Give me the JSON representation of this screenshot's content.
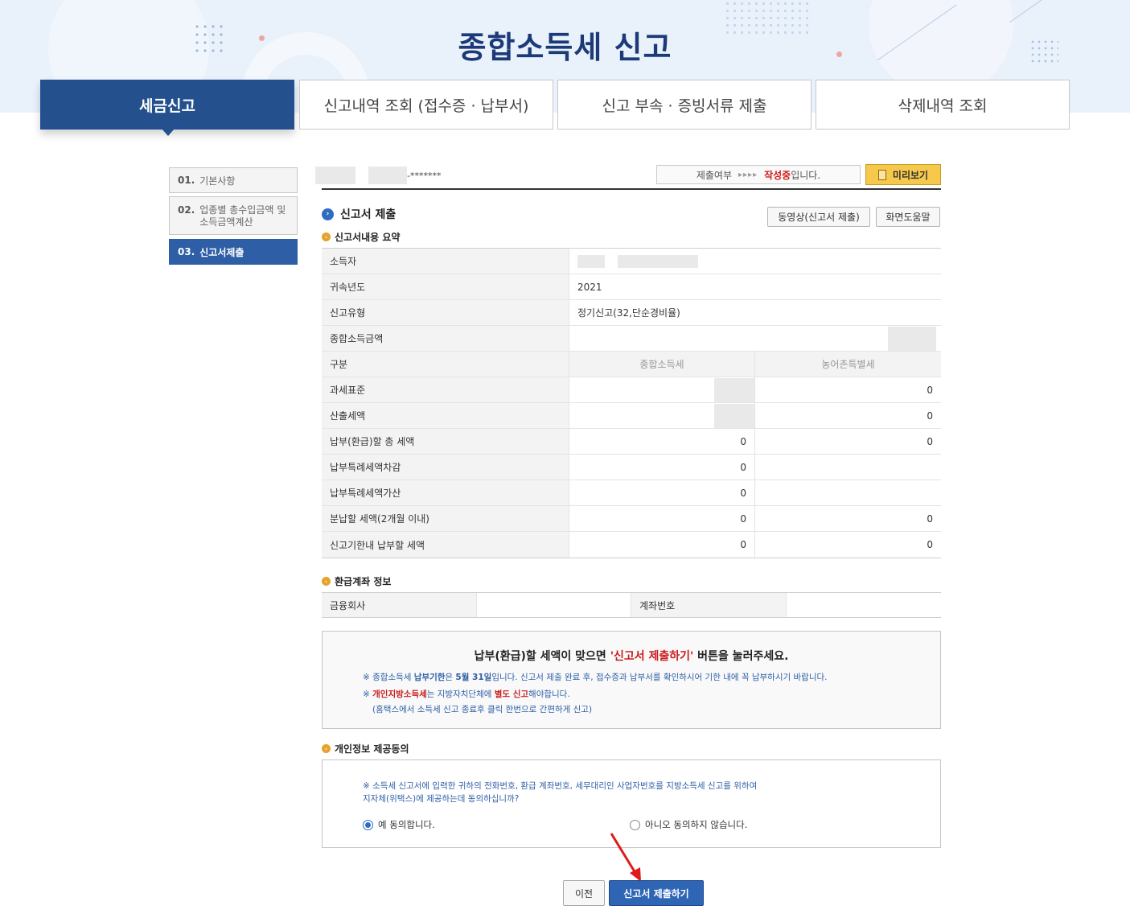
{
  "page": {
    "title": "종합소득세 신고"
  },
  "tabs": [
    {
      "label": "세금신고",
      "active": true
    },
    {
      "label": "신고내역 조회 (접수증 · 납부서)",
      "active": false
    },
    {
      "label": "신고 부속 · 증빙서류 제출",
      "active": false
    },
    {
      "label": "삭제내역 조회",
      "active": false
    }
  ],
  "steps": [
    {
      "num": "01.",
      "label": "기본사항",
      "active": false
    },
    {
      "num": "02.",
      "label": "업종별 총수입금액 및 소득금액계산",
      "active": false
    },
    {
      "num": "03.",
      "label": "신고서제출",
      "active": true
    }
  ],
  "user": {
    "masked": "-*******"
  },
  "status": {
    "label": "제출여부",
    "arrows": "▸▸▸▸",
    "state": "작성중",
    "suffix": "입니다."
  },
  "preview_button": "미리보기",
  "section": {
    "title": "신고서 제출",
    "video_button": "동영상(신고서 제출)",
    "help_button": "화면도움말"
  },
  "summary": {
    "title": "신고서내용 요약",
    "rows": {
      "taxpayer": "소득자",
      "year_label": "귀속년도",
      "year": "2021",
      "type_label": "신고유형",
      "type": "정기신고(32,단순경비율)",
      "income_label": "종합소득금액",
      "category_label": "구분",
      "col1": "종합소득세",
      "col2": "농어촌특별세",
      "tax_base": "과세표준",
      "tax_base_c2": "0",
      "computed_tax": "산출세액",
      "computed_tax_c2": "0",
      "total_payable": "납부(환급)할 총 세액",
      "total_payable_c1": "0",
      "total_payable_c2": "0",
      "special_deduct": "납부특례세액차감",
      "special_deduct_c1": "0",
      "special_add": "납부특례세액가산",
      "special_add_c1": "0",
      "installment": "분납할 세액(2개월 이내)",
      "installment_c1": "0",
      "installment_c2": "0",
      "due_payment": "신고기한내 납부할 세액",
      "due_payment_c1": "0",
      "due_payment_c2": "0"
    }
  },
  "refund": {
    "title": "환급계좌 정보",
    "bank_label": "금융회사",
    "account_label": "계좌번호"
  },
  "notice": {
    "main_pre": "납부(환급)할 세액이 맞으면 ",
    "main_red": "'신고서 제출하기'",
    "main_post": " 버튼을 눌러주세요.",
    "l1_pre": "※ 종합소득세 ",
    "l1_b1": "납부기한",
    "l1_mid": "은 ",
    "l1_b2": "5월 31일",
    "l1_post": "입니다. 신고서 제출 완료 후, 접수증과 납부서를 확인하시어 기한 내에 꼭 납부하시기 바랍니다.",
    "l2_pre": "※ ",
    "l2_red": "개인지방소득세",
    "l2_mid": "는 지방자치단체에 ",
    "l2_red2": "별도 신고",
    "l2_post": "해야합니다.",
    "l3": "(홈택스에서 소득세 신고 종료후 클릭 한번으로 간편하게 신고)"
  },
  "consent": {
    "title": "개인정보 제공동의",
    "q1": "※ 소득세 신고서에 입력한 귀하의 전화번호, 환급 계좌번호, 세무대리인 사업자번호를 지방소득세 신고를 위하여",
    "q2": "지자체(위택스)에 제공하는데 동의하십니까?",
    "yes": "예 동의합니다.",
    "no": "아니오 동의하지 않습니다.",
    "selected": "yes"
  },
  "buttons": {
    "prev": "이전",
    "submit": "신고서 제출하기"
  },
  "colors": {
    "primary": "#24518e",
    "accent_red": "#c81c1c",
    "preview_yellow": "#f6c84c"
  }
}
